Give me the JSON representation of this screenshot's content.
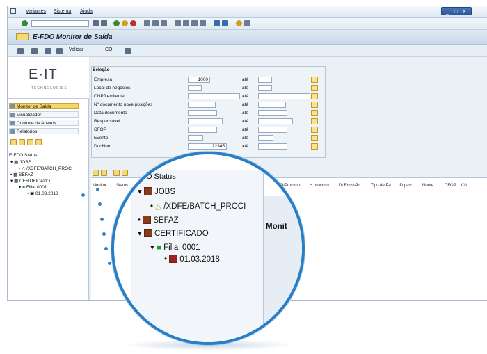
{
  "menu": [
    "Variantes",
    "Sistema",
    "Ajuda"
  ],
  "window_controls": [
    "_",
    "□",
    "×"
  ],
  "title": "E-FDO Monitor de Saída",
  "app_toolbar": {
    "validar": "Validar",
    "co": "CO"
  },
  "logo": {
    "text": "E·IT",
    "sub": "TECHNOLOGIES"
  },
  "nav": [
    "Monitor de Saída",
    "Visualizador",
    "Controle de Anexos",
    "Relatórios"
  ],
  "tree": {
    "header": "E-FDO Status",
    "items": [
      "JOBS",
      "/XDFE/BATCH_PROC",
      "SEFAZ",
      "CERTIFICADO",
      "Filial 0001",
      "01.03.2018"
    ]
  },
  "selecao": {
    "title": "Seleção",
    "ate": "até",
    "fields": [
      {
        "label": "Empresa",
        "value": "1000"
      },
      {
        "label": "Local de negócios",
        "value": ""
      },
      {
        "label": "CNPJ emitente",
        "value": ""
      },
      {
        "label": "Nº documento nove posições",
        "value": ""
      },
      {
        "label": "Data documento",
        "value": ""
      },
      {
        "label": "Responsável",
        "value": ""
      },
      {
        "label": "CFOP",
        "value": ""
      },
      {
        "label": "Evento",
        "value": ""
      },
      {
        "label": "DocNum",
        "value": "12345"
      }
    ]
  },
  "grid_headers": [
    "Monitor",
    "Status",
    "DtProcmto.",
    "H.procmto.",
    "Dt Emissão",
    "Tipo de Pa",
    "ID parc.",
    "Nome 1",
    "CFOP",
    "Có..."
  ],
  "magnifier": {
    "header": "DO Status",
    "rows": [
      "JOBS",
      "/XDFE/BATCH_PROCI",
      "SEFAZ",
      "CERTIFICADO",
      "Filial 0001",
      "01.03.2018"
    ],
    "side": "Monit"
  }
}
